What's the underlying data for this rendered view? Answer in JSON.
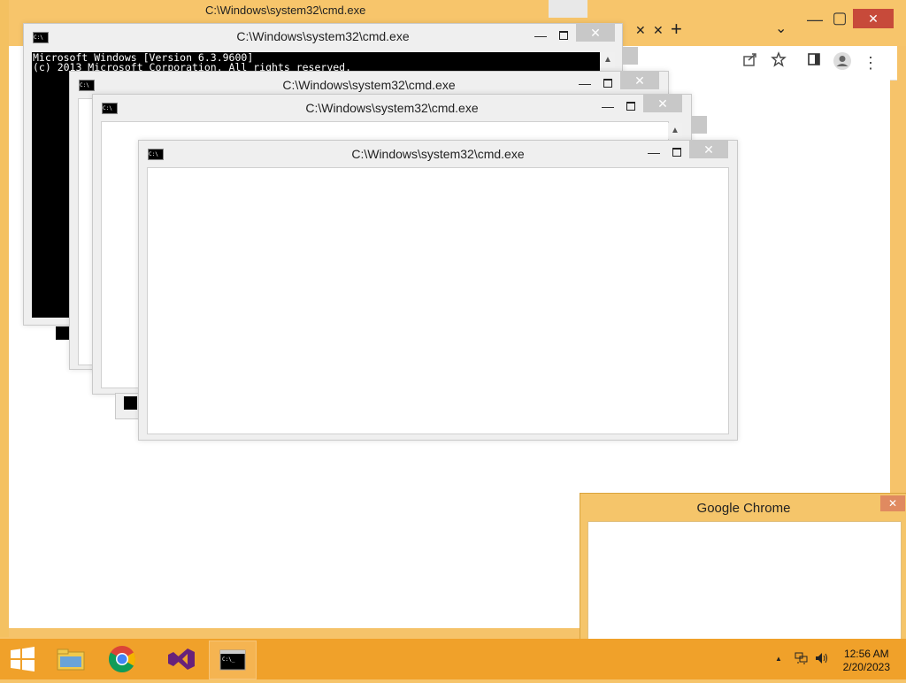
{
  "chrome": {
    "tab_title": "C:\\Windows\\system32\\cmd.exe",
    "new_tab": "+",
    "tab_close": "✕",
    "tab_close2": "✕",
    "dropdown": "⌄",
    "minimize": "—",
    "maximize": "▢",
    "close": "✕",
    "toolbar_icons": [
      "share-icon",
      "star-icon",
      "sidebar-icon",
      "profile-icon",
      "menu-icon"
    ]
  },
  "cmd_windows": [
    {
      "title": "C:\\Windows\\system32\\cmd.exe",
      "console_lines": [
        "Microsoft Windows [Version 6.3.9600]",
        "(c) 2013 Microsoft Corporation. All rights reserved."
      ]
    },
    {
      "title": "C:\\Windows\\system32\\cmd.exe"
    },
    {
      "title": "C:\\Windows\\system32\\cmd.exe"
    },
    {
      "title": "C:\\Windows\\system32\\cmd.exe"
    }
  ],
  "cmd_controls": {
    "minimize": "—",
    "close": "✕"
  },
  "popup": {
    "title": "Google Chrome",
    "close": "✕"
  },
  "taskbar": {
    "apps": [
      "start-button",
      "file-explorer",
      "google-chrome",
      "visual-studio",
      "command-prompt"
    ],
    "tray": {
      "up_arrow": "▲"
    },
    "clock": {
      "time": "12:56 AM",
      "date": "2/20/2023"
    }
  },
  "colors": {
    "accent": "#f0a12a",
    "chrome_frame": "#f6c36a",
    "close_red": "#c74a3a",
    "cmd_close": "#c8c8c8"
  }
}
